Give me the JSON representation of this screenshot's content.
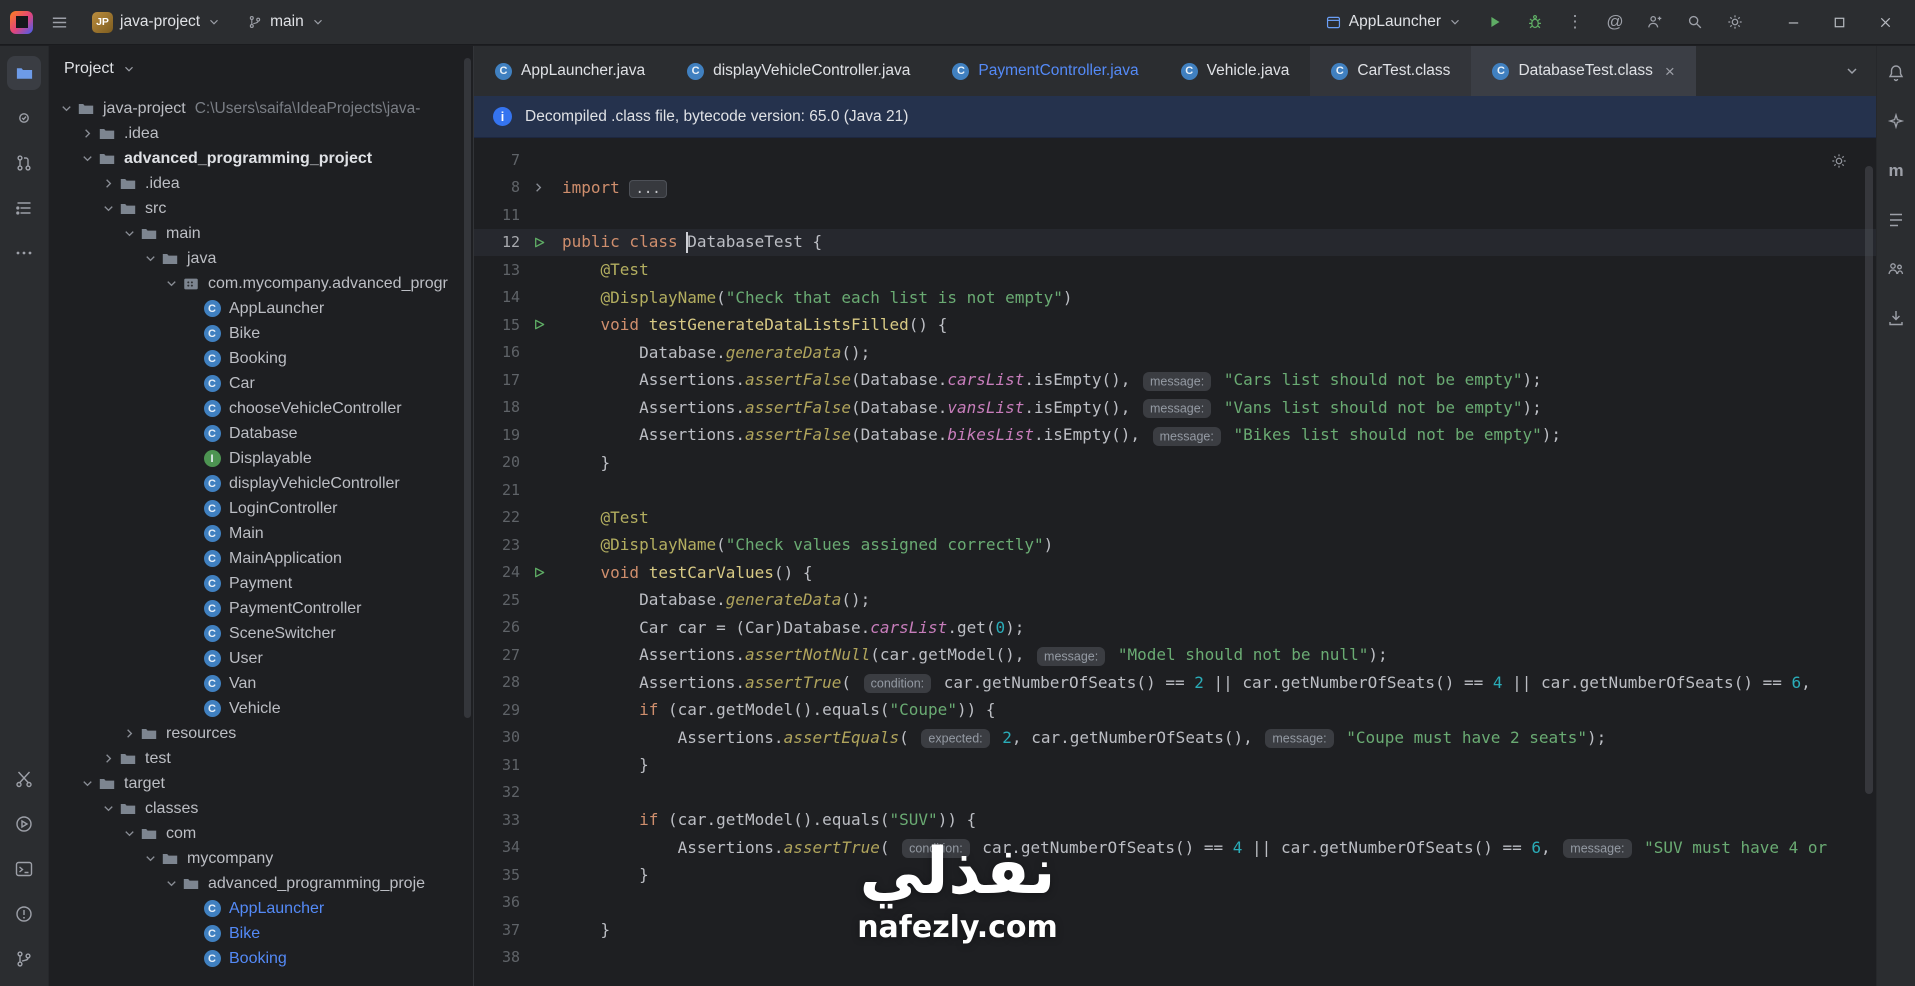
{
  "titlebar": {
    "project_name": "java-project",
    "project_badge": "JP",
    "branch": "main",
    "run_config": "AppLauncher"
  },
  "icons": {
    "class_letter": "C",
    "interface_letter": "I",
    "maven_letter": "m",
    "at_symbol": "@",
    "more_vertical": "⋮",
    "more_horizontal": "⋯",
    "close_glyph": "×"
  },
  "left_strip_top": [
    "project",
    "commit",
    "pull-requests",
    "structure",
    "more-tool-windows"
  ],
  "left_strip_bottom": [
    "build-tools",
    "services",
    "terminal",
    "problems",
    "version-control"
  ],
  "right_strip": [
    "notifications",
    "ai-assistant",
    "maven",
    "bookmarks",
    "collaboration",
    "download"
  ],
  "tabs": [
    {
      "label": "AppLauncher.java",
      "icon": "class"
    },
    {
      "label": "displayVehicleController.java",
      "icon": "class"
    },
    {
      "label": "PaymentController.java",
      "icon": "class",
      "label_color": "blue"
    },
    {
      "label": "Vehicle.java",
      "icon": "class"
    },
    {
      "label": "CarTest.class",
      "icon": "class",
      "raised": true
    },
    {
      "label": "DatabaseTest.class",
      "icon": "class",
      "active": true,
      "closable": true
    }
  ],
  "banner": {
    "text": "Decompiled .class file, bytecode version: 65.0 (Java 21)"
  },
  "project_panel": {
    "title": "Project",
    "tree": [
      {
        "label": "java-project",
        "path": "C:\\Users\\saifa\\IdeaProjects\\java-",
        "depth": 0,
        "icon": "project",
        "chevron": "expanded"
      },
      {
        "label": ".idea",
        "depth": 1,
        "icon": "folder",
        "chevron": "collapsed"
      },
      {
        "label": "advanced_programming_project",
        "depth": 1,
        "icon": "folder",
        "chevron": "expanded",
        "bold": true
      },
      {
        "label": ".idea",
        "depth": 2,
        "icon": "folder",
        "chevron": "collapsed"
      },
      {
        "label": "src",
        "depth": 2,
        "icon": "folder",
        "chevron": "expanded"
      },
      {
        "label": "main",
        "depth": 3,
        "icon": "folder",
        "chevron": "expanded"
      },
      {
        "label": "java",
        "depth": 4,
        "icon": "folder",
        "chevron": "expanded"
      },
      {
        "label": "com.mycompany.advanced_progr",
        "depth": 5,
        "icon": "package",
        "chevron": "expanded"
      },
      {
        "label": "AppLauncher",
        "depth": 6,
        "icon": "class",
        "chevron": "none"
      },
      {
        "label": "Bike",
        "depth": 6,
        "icon": "class",
        "chevron": "none"
      },
      {
        "label": "Booking",
        "depth": 6,
        "icon": "class",
        "chevron": "none"
      },
      {
        "label": "Car",
        "depth": 6,
        "icon": "class",
        "chevron": "none"
      },
      {
        "label": "chooseVehicleController",
        "depth": 6,
        "icon": "class",
        "chevron": "none"
      },
      {
        "label": "Database",
        "depth": 6,
        "icon": "class",
        "chevron": "none"
      },
      {
        "label": "Displayable",
        "depth": 6,
        "icon": "interface",
        "chevron": "none"
      },
      {
        "label": "displayVehicleController",
        "depth": 6,
        "icon": "class",
        "chevron": "none"
      },
      {
        "label": "LoginController",
        "depth": 6,
        "icon": "class",
        "chevron": "none"
      },
      {
        "label": "Main",
        "depth": 6,
        "icon": "class",
        "chevron": "none"
      },
      {
        "label": "MainApplication",
        "depth": 6,
        "icon": "class",
        "chevron": "none"
      },
      {
        "label": "Payment",
        "depth": 6,
        "icon": "class",
        "chevron": "none"
      },
      {
        "label": "PaymentController",
        "depth": 6,
        "icon": "class",
        "chevron": "none"
      },
      {
        "label": "SceneSwitcher",
        "depth": 6,
        "icon": "class",
        "chevron": "none"
      },
      {
        "label": "User",
        "depth": 6,
        "icon": "class",
        "chevron": "none"
      },
      {
        "label": "Van",
        "depth": 6,
        "icon": "class",
        "chevron": "none"
      },
      {
        "label": "Vehicle",
        "depth": 6,
        "icon": "class",
        "chevron": "none"
      },
      {
        "label": "resources",
        "depth": 3,
        "icon": "folder",
        "chevron": "collapsed"
      },
      {
        "label": "test",
        "depth": 2,
        "icon": "folder",
        "chevron": "collapsed"
      },
      {
        "label": "target",
        "depth": 1,
        "icon": "folder",
        "chevron": "expanded"
      },
      {
        "label": "classes",
        "depth": 2,
        "icon": "folder",
        "chevron": "expanded"
      },
      {
        "label": "com",
        "depth": 3,
        "icon": "folder",
        "chevron": "expanded"
      },
      {
        "label": "mycompany",
        "depth": 4,
        "icon": "folder",
        "chevron": "expanded"
      },
      {
        "label": "advanced_programming_proje",
        "depth": 5,
        "icon": "folder",
        "chevron": "expanded"
      },
      {
        "label": "AppLauncher",
        "depth": 6,
        "icon": "class",
        "chevron": "none",
        "label_color": "blue"
      },
      {
        "label": "Bike",
        "depth": 6,
        "icon": "class",
        "chevron": "none",
        "label_color": "blue"
      },
      {
        "label": "Booking",
        "depth": 6,
        "icon": "class",
        "chevron": "none",
        "label_color": "blue"
      }
    ]
  },
  "editor": {
    "lines": [
      {
        "num": "7",
        "tokens": []
      },
      {
        "num": "8",
        "gutter": "fold",
        "tokens": [
          [
            "import ",
            "k"
          ],
          [
            "...",
            "f"
          ]
        ]
      },
      {
        "num": "11",
        "tokens": []
      },
      {
        "num": "12",
        "gutter": "run",
        "current": true,
        "tokens": [
          [
            "public class ",
            "k"
          ],
          [
            "",
            "caret"
          ],
          [
            "DatabaseTest {",
            "p"
          ]
        ]
      },
      {
        "num": "13",
        "tokens": [
          [
            "    ",
            "p"
          ],
          [
            "@Test",
            "a"
          ]
        ]
      },
      {
        "num": "14",
        "tokens": [
          [
            "    ",
            "p"
          ],
          [
            "@DisplayName",
            "a"
          ],
          [
            "(",
            "p"
          ],
          [
            "\"Check that each list is not empty\"",
            "s"
          ],
          [
            ")",
            "p"
          ]
        ]
      },
      {
        "num": "15",
        "gutter": "run",
        "tokens": [
          [
            "    ",
            "p"
          ],
          [
            "void ",
            "k"
          ],
          [
            "testGenerateDataListsFilled",
            "d"
          ],
          [
            "() {",
            "p"
          ]
        ]
      },
      {
        "num": "16",
        "tokens": [
          [
            "        ",
            "p"
          ],
          [
            "Database.",
            "p"
          ],
          [
            "generateData",
            "sm"
          ],
          [
            "();",
            "p"
          ]
        ]
      },
      {
        "num": "17",
        "tokens": [
          [
            "        ",
            "p"
          ],
          [
            "Assertions.",
            "p"
          ],
          [
            "assertFalse",
            "sm"
          ],
          [
            "(Database.",
            "p"
          ],
          [
            "carsList",
            "sf"
          ],
          [
            ".isEmpty(), ",
            "p"
          ],
          [
            "message:",
            "h"
          ],
          [
            " ",
            "p"
          ],
          [
            "\"Cars list should not be empty\"",
            "s"
          ],
          [
            ");",
            "p"
          ]
        ]
      },
      {
        "num": "18",
        "tokens": [
          [
            "        ",
            "p"
          ],
          [
            "Assertions.",
            "p"
          ],
          [
            "assertFalse",
            "sm"
          ],
          [
            "(Database.",
            "p"
          ],
          [
            "vansList",
            "sf"
          ],
          [
            ".isEmpty(), ",
            "p"
          ],
          [
            "message:",
            "h"
          ],
          [
            " ",
            "p"
          ],
          [
            "\"Vans list should not be empty\"",
            "s"
          ],
          [
            ");",
            "p"
          ]
        ]
      },
      {
        "num": "19",
        "tokens": [
          [
            "        ",
            "p"
          ],
          [
            "Assertions.",
            "p"
          ],
          [
            "assertFalse",
            "sm"
          ],
          [
            "(Database.",
            "p"
          ],
          [
            "bikesList",
            "sf"
          ],
          [
            ".isEmpty(), ",
            "p"
          ],
          [
            "message:",
            "h"
          ],
          [
            " ",
            "p"
          ],
          [
            "\"Bikes list should not be empty\"",
            "s"
          ],
          [
            ");",
            "p"
          ]
        ]
      },
      {
        "num": "20",
        "tokens": [
          [
            "    }",
            "p"
          ]
        ]
      },
      {
        "num": "21",
        "tokens": []
      },
      {
        "num": "22",
        "tokens": [
          [
            "    ",
            "p"
          ],
          [
            "@Test",
            "a"
          ]
        ]
      },
      {
        "num": "23",
        "tokens": [
          [
            "    ",
            "p"
          ],
          [
            "@DisplayName",
            "a"
          ],
          [
            "(",
            "p"
          ],
          [
            "\"Check values assigned correctly\"",
            "s"
          ],
          [
            ")",
            "p"
          ]
        ]
      },
      {
        "num": "24",
        "gutter": "run",
        "tokens": [
          [
            "    ",
            "p"
          ],
          [
            "void ",
            "k"
          ],
          [
            "testCarValues",
            "d"
          ],
          [
            "() {",
            "p"
          ]
        ]
      },
      {
        "num": "25",
        "tokens": [
          [
            "        ",
            "p"
          ],
          [
            "Database.",
            "p"
          ],
          [
            "generateData",
            "sm"
          ],
          [
            "();",
            "p"
          ]
        ]
      },
      {
        "num": "26",
        "tokens": [
          [
            "        ",
            "p"
          ],
          [
            "Car car = (Car)Database.",
            "p"
          ],
          [
            "carsList",
            "sf"
          ],
          [
            ".get(",
            "p"
          ],
          [
            "0",
            "n"
          ],
          [
            ");",
            "p"
          ]
        ]
      },
      {
        "num": "27",
        "tokens": [
          [
            "        ",
            "p"
          ],
          [
            "Assertions.",
            "p"
          ],
          [
            "assertNotNull",
            "sm"
          ],
          [
            "(car.getModel(), ",
            "p"
          ],
          [
            "message:",
            "h"
          ],
          [
            " ",
            "p"
          ],
          [
            "\"Model should not be null\"",
            "s"
          ],
          [
            ");",
            "p"
          ]
        ]
      },
      {
        "num": "28",
        "tokens": [
          [
            "        ",
            "p"
          ],
          [
            "Assertions.",
            "p"
          ],
          [
            "assertTrue",
            "sm"
          ],
          [
            "( ",
            "p"
          ],
          [
            "condition:",
            "h"
          ],
          [
            " car.getNumberOfSeats() == ",
            "p"
          ],
          [
            "2",
            "n"
          ],
          [
            " || car.getNumberOfSeats() == ",
            "p"
          ],
          [
            "4",
            "n"
          ],
          [
            " || car.getNumberOfSeats() == ",
            "p"
          ],
          [
            "6",
            "n"
          ],
          [
            ",",
            "p"
          ]
        ]
      },
      {
        "num": "29",
        "tokens": [
          [
            "        ",
            "p"
          ],
          [
            "if",
            "k"
          ],
          [
            " (car.getModel().equals(",
            "p"
          ],
          [
            "\"Coupe\"",
            "s"
          ],
          [
            ")) {",
            "p"
          ]
        ]
      },
      {
        "num": "30",
        "tokens": [
          [
            "            ",
            "p"
          ],
          [
            "Assertions.",
            "p"
          ],
          [
            "assertEquals",
            "sm"
          ],
          [
            "( ",
            "p"
          ],
          [
            "expected:",
            "h"
          ],
          [
            " ",
            "p"
          ],
          [
            "2",
            "n"
          ],
          [
            ", car.getNumberOfSeats(), ",
            "p"
          ],
          [
            "message:",
            "h"
          ],
          [
            " ",
            "p"
          ],
          [
            "\"Coupe must have 2 seats\"",
            "s"
          ],
          [
            ");",
            "p"
          ]
        ]
      },
      {
        "num": "31",
        "tokens": [
          [
            "        }",
            "p"
          ]
        ]
      },
      {
        "num": "32",
        "tokens": []
      },
      {
        "num": "33",
        "tokens": [
          [
            "        ",
            "p"
          ],
          [
            "if",
            "k"
          ],
          [
            " (car.getModel().equals(",
            "p"
          ],
          [
            "\"SUV\"",
            "s"
          ],
          [
            ")) {",
            "p"
          ]
        ]
      },
      {
        "num": "34",
        "tokens": [
          [
            "            ",
            "p"
          ],
          [
            "Assertions.",
            "p"
          ],
          [
            "assertTrue",
            "sm"
          ],
          [
            "( ",
            "p"
          ],
          [
            "condition:",
            "h"
          ],
          [
            " car.getNumberOfSeats() == ",
            "p"
          ],
          [
            "4",
            "n"
          ],
          [
            " || car.getNumberOfSeats() == ",
            "p"
          ],
          [
            "6",
            "n"
          ],
          [
            ", ",
            "p"
          ],
          [
            "message:",
            "h"
          ],
          [
            " ",
            "p"
          ],
          [
            "\"SUV must have 4 or",
            "s"
          ]
        ]
      },
      {
        "num": "35",
        "tokens": [
          [
            "        }",
            "p"
          ]
        ]
      },
      {
        "num": "36",
        "tokens": []
      },
      {
        "num": "37",
        "tokens": [
          [
            "    }",
            "p"
          ]
        ]
      },
      {
        "num": "38",
        "tokens": []
      }
    ]
  },
  "watermark": {
    "title": "نفذلي",
    "url": "nafezly.com"
  },
  "colors": {
    "accent": "#3574f0",
    "run_green": "#5fad65",
    "keyword": "#cf8e6d",
    "string": "#6aab73",
    "annotation": "#b3ae60",
    "number": "#2aacb8",
    "static_field": "#c77dbb",
    "banner_bg": "#25324d",
    "compiled_class_label": "#548af7"
  }
}
